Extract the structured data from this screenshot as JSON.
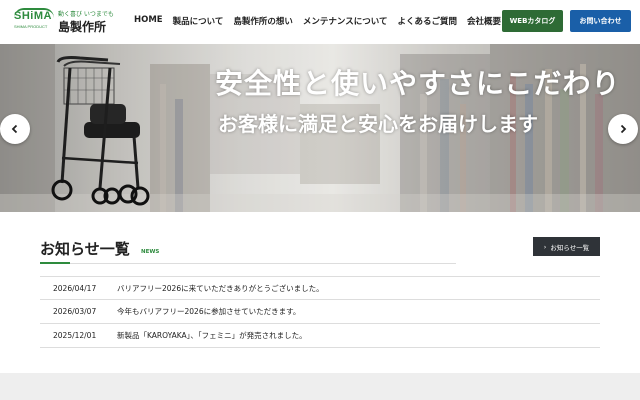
{
  "header": {
    "logo_mark": "SHiMA",
    "logo_sub": "SHIMA PRODUCT",
    "logo_tagline": "動く喜び いつまでも",
    "logo_name": "島製作所",
    "nav": [
      "HOME",
      "製品について",
      "島製作所の想い",
      "メンテナンスについて",
      "よくあるご質問",
      "会社概要"
    ],
    "catalog_button": "WEBカタログ",
    "contact_button": "お問い合わせ"
  },
  "hero": {
    "line1": "安全性と使いやすさにこだわり",
    "line2": "お客様に満足と安心をお届けします"
  },
  "news": {
    "title": "お知らせ一覧",
    "subtitle": "NEWS",
    "more_button": "お知らせ一覧",
    "items": [
      {
        "date": "2026/04/17",
        "text": "バリアフリー2026に来ていただきありがとうございました。"
      },
      {
        "date": "2026/03/07",
        "text": "今年もバリアフリー2026に参加させていただきます。"
      },
      {
        "date": "2025/12/01",
        "text": "新製品「KAROYAKA」、「フェミニ」が発売されました。"
      }
    ]
  },
  "colors": {
    "brand_green": "#2e8b3e",
    "catalog_bg": "#2e6b35",
    "contact_bg": "#1a5fa8",
    "dark_button": "#2f3338"
  }
}
